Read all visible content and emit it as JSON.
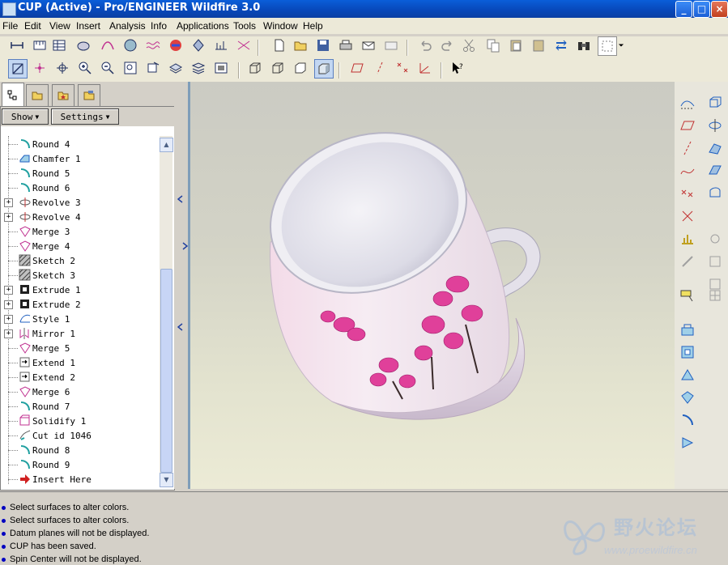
{
  "window": {
    "title": "CUP (Active) - Pro/ENGINEER Wildfire 3.0"
  },
  "menu": [
    "File",
    "Edit",
    "View",
    "Insert",
    "Analysis",
    "Info",
    "Applications",
    "Tools",
    "Window",
    "Help"
  ],
  "navigator": {
    "show_label": "Show",
    "settings_label": "Settings",
    "items": [
      {
        "label": "Round 4",
        "icon": "round-icon",
        "expandable": false
      },
      {
        "label": "Chamfer 1",
        "icon": "chamfer-icon",
        "expandable": false
      },
      {
        "label": "Round 5",
        "icon": "round-icon",
        "expandable": false
      },
      {
        "label": "Round 6",
        "icon": "round-icon",
        "expandable": false
      },
      {
        "label": "Revolve 3",
        "icon": "revolve-icon",
        "expandable": true
      },
      {
        "label": "Revolve 4",
        "icon": "revolve-icon",
        "expandable": true
      },
      {
        "label": "Merge 3",
        "icon": "merge-icon",
        "expandable": false
      },
      {
        "label": "Merge 4",
        "icon": "merge-icon",
        "expandable": false
      },
      {
        "label": "Sketch 2",
        "icon": "sketch-icon",
        "expandable": false
      },
      {
        "label": "Sketch 3",
        "icon": "sketch-icon",
        "expandable": false
      },
      {
        "label": "Extrude 1",
        "icon": "extrude-icon",
        "expandable": true
      },
      {
        "label": "Extrude 2",
        "icon": "extrude-icon",
        "expandable": true
      },
      {
        "label": "Style 1",
        "icon": "style-icon",
        "expandable": true
      },
      {
        "label": "Mirror 1",
        "icon": "mirror-icon",
        "expandable": true
      },
      {
        "label": "Merge 5",
        "icon": "merge-icon",
        "expandable": false
      },
      {
        "label": "Extend 1",
        "icon": "extend-icon",
        "expandable": false
      },
      {
        "label": "Extend 2",
        "icon": "extend-icon",
        "expandable": false
      },
      {
        "label": "Merge 6",
        "icon": "merge-icon",
        "expandable": false
      },
      {
        "label": "Round 7",
        "icon": "round-icon",
        "expandable": false
      },
      {
        "label": "Solidify 1",
        "icon": "solidify-icon",
        "expandable": false
      },
      {
        "label": "Cut id 1046",
        "icon": "cut-icon",
        "expandable": false
      },
      {
        "label": "Round 8",
        "icon": "round-icon",
        "expandable": false
      },
      {
        "label": "Round 9",
        "icon": "round-icon",
        "expandable": false
      },
      {
        "label": "Insert Here",
        "icon": "insert-arrow-icon",
        "expandable": false
      }
    ]
  },
  "messages": [
    "Select surfaces to alter colors.",
    "Select surfaces to alter colors.",
    "Datum planes will not be displayed.",
    "CUP has been saved.",
    "Spin Center will not be displayed."
  ],
  "watermark": {
    "cn": "野火论坛",
    "url": "www.proewildfire.cn"
  },
  "colors": {
    "title_bar": "#0a5ed9",
    "viewport_top": "#cbcbc3",
    "viewport_bottom": "#ecebd6",
    "cup": "#e8e4ee",
    "flower": "#e0409a"
  }
}
